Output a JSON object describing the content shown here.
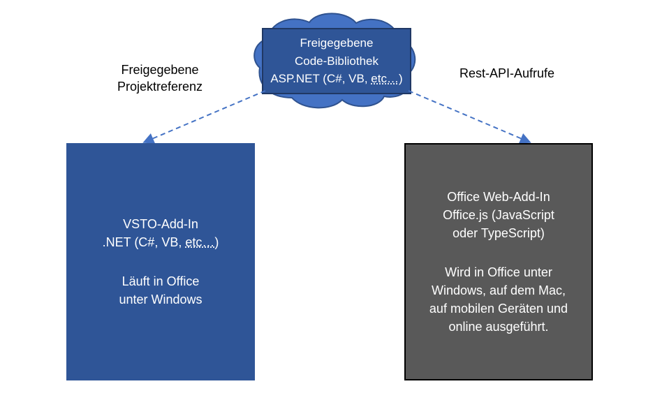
{
  "colors": {
    "cloud_fill": "#4472c4",
    "cloud_stroke": "#2f528f",
    "cloud_box_fill": "#2f5597",
    "cloud_box_border": "#203864",
    "left_box_fill": "#2f5597",
    "right_box_fill": "#595959",
    "right_box_border": "#000000",
    "arrow": "#4472c4",
    "text_light": "#ffffff",
    "text_dark": "#000000"
  },
  "cloud_box": {
    "line1": "Freigegebene",
    "line2": "Code-Bibliothek",
    "line3_prefix": "ASP.NET (C#, VB, ",
    "line3_etc": "etc…",
    "line3_suffix": ")"
  },
  "left_label": {
    "line1": "Freigegebene",
    "line2": "Projektreferenz"
  },
  "right_label": {
    "line1": "Rest-API-Aufrufe"
  },
  "left_box": {
    "g1_line1": "VSTO-Add-In",
    "g1_line2_prefix": ".NET (C#, VB, ",
    "g1_line2_etc": "etc…",
    "g1_line2_suffix": ")",
    "g2_line1": "Läuft in Office",
    "g2_line2": "unter Windows"
  },
  "right_box": {
    "g1_line1": "Office Web-Add-In",
    "g1_line2": "Office.js (JavaScript",
    "g1_line3": "oder TypeScript)",
    "g2_line1": "Wird in Office unter",
    "g2_line2": "Windows, auf dem Mac,",
    "g2_line3": "auf mobilen Geräten und",
    "g2_line4": "online ausgeführt."
  }
}
